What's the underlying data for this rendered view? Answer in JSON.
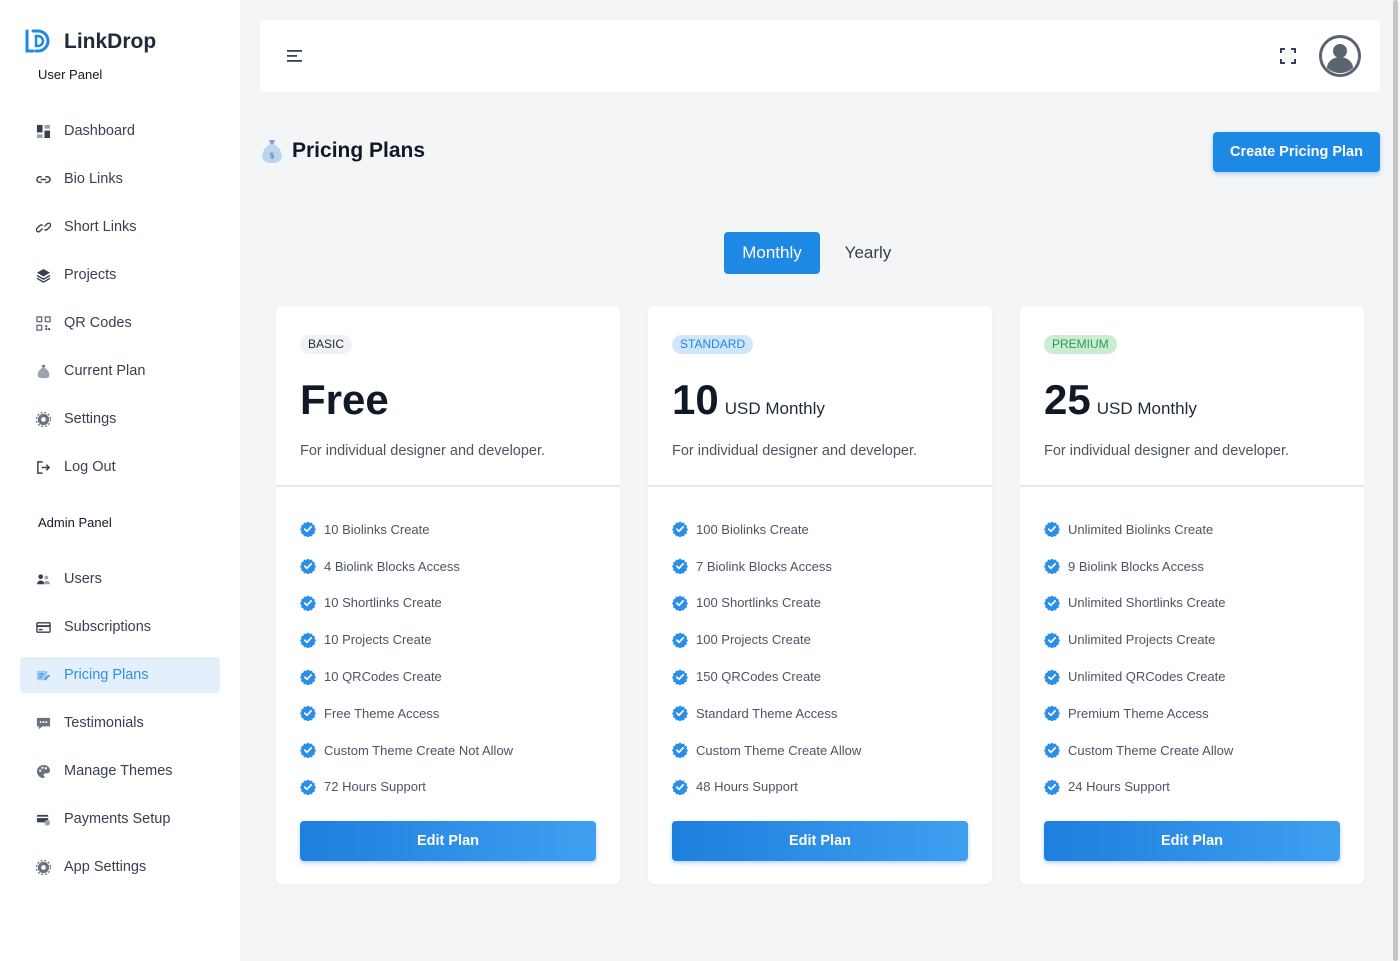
{
  "brand": {
    "name": "LinkDrop"
  },
  "sidebar": {
    "user_heading": "User Panel",
    "admin_heading": "Admin Panel",
    "user_items": [
      {
        "label": "Dashboard",
        "icon": "dashboard-icon"
      },
      {
        "label": "Bio Links",
        "icon": "link-icon"
      },
      {
        "label": "Short Links",
        "icon": "chain-link-icon"
      },
      {
        "label": "Projects",
        "icon": "layers-icon"
      },
      {
        "label": "QR Codes",
        "icon": "qr-code-icon"
      },
      {
        "label": "Current Plan",
        "icon": "money-bag-icon"
      },
      {
        "label": "Settings",
        "icon": "gear-icon"
      },
      {
        "label": "Log Out",
        "icon": "logout-icon"
      }
    ],
    "admin_items": [
      {
        "label": "Users",
        "icon": "users-icon"
      },
      {
        "label": "Subscriptions",
        "icon": "card-icon"
      },
      {
        "label": "Pricing Plans",
        "icon": "price-tag-icon",
        "active": true
      },
      {
        "label": "Testimonials",
        "icon": "comment-icon"
      },
      {
        "label": "Manage Themes",
        "icon": "palette-icon"
      },
      {
        "label": "Payments Setup",
        "icon": "payment-icon"
      },
      {
        "label": "App Settings",
        "icon": "gear-icon"
      }
    ]
  },
  "page": {
    "title": "Pricing Plans",
    "title_icon": "money-bag-icon",
    "create_button": "Create Pricing Plan"
  },
  "billing_toggle": {
    "monthly": "Monthly",
    "yearly": "Yearly",
    "selected": "Monthly"
  },
  "plans": [
    {
      "badge": "BASIC",
      "price": "Free",
      "period": "",
      "description": "For individual designer and developer.",
      "features": [
        "10 Biolinks Create",
        "4 Biolink Blocks Access",
        "10 Shortlinks Create",
        "10 Projects Create",
        "10 QRCodes Create",
        "Free Theme Access",
        "Custom Theme Create Not Allow",
        "72 Hours Support"
      ],
      "button": "Edit Plan"
    },
    {
      "badge": "STANDARD",
      "price": "10",
      "period": "USD Monthly",
      "description": "For individual designer and developer.",
      "features": [
        "100 Biolinks Create",
        "7 Biolink Blocks Access",
        "100 Shortlinks Create",
        "100 Projects Create",
        "150 QRCodes Create",
        "Standard Theme Access",
        "Custom Theme Create Allow",
        "48 Hours Support"
      ],
      "button": "Edit Plan"
    },
    {
      "badge": "PREMIUM",
      "price": "25",
      "period": "USD Monthly",
      "description": "For individual designer and developer.",
      "features": [
        "Unlimited Biolinks Create",
        "9 Biolink Blocks Access",
        "Unlimited Shortlinks Create",
        "Unlimited Projects Create",
        "Unlimited QRCodes Create",
        "Premium Theme Access",
        "Custom Theme Create Allow",
        "24 Hours Support"
      ],
      "button": "Edit Plan"
    }
  ],
  "colors": {
    "primary": "#1e88e5",
    "sidebar_active_bg": "#e3f0fc",
    "badge_standard": "#cfe6fb",
    "badge_premium": "#c9ecd2"
  }
}
